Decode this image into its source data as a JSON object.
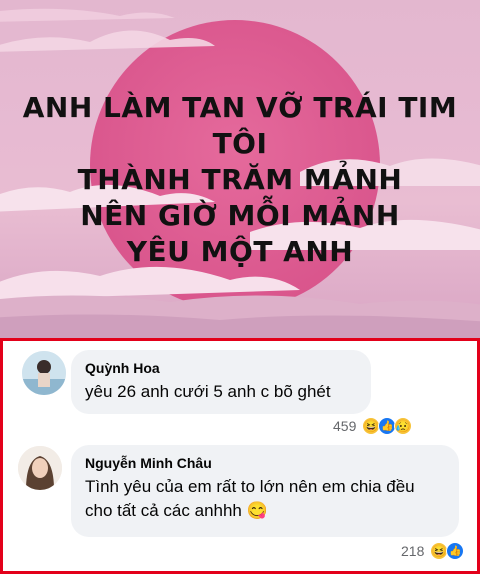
{
  "meme": {
    "lines": [
      "ANH LÀM TAN VỠ TRÁI TIM TÔI",
      "THÀNH TRĂM MẢNH",
      "NÊN GIỜ MỖI MẢNH",
      "YÊU MỘT ANH"
    ]
  },
  "comments": [
    {
      "name": "Quỳnh Hoa",
      "text": "yêu 26 anh cưới 5 anh c bõ ghét",
      "reaction_count": "459",
      "reactions": [
        "haha-icon",
        "like-icon",
        "sad-icon"
      ]
    },
    {
      "name": "Nguyễn Minh Châu",
      "text_line1": "Tình yêu của em rất to lớn nên em chia đều",
      "text_line2": "cho tất cả các anhhh",
      "emoji": "😋",
      "reaction_count": "218",
      "reactions": [
        "haha-icon",
        "like-icon"
      ]
    }
  ],
  "colors": {
    "highlight_border": "#e3001a",
    "bubble_bg": "#f0f2f5",
    "like_blue": "#1877f2",
    "meme_pink": "#e6b8cf"
  }
}
